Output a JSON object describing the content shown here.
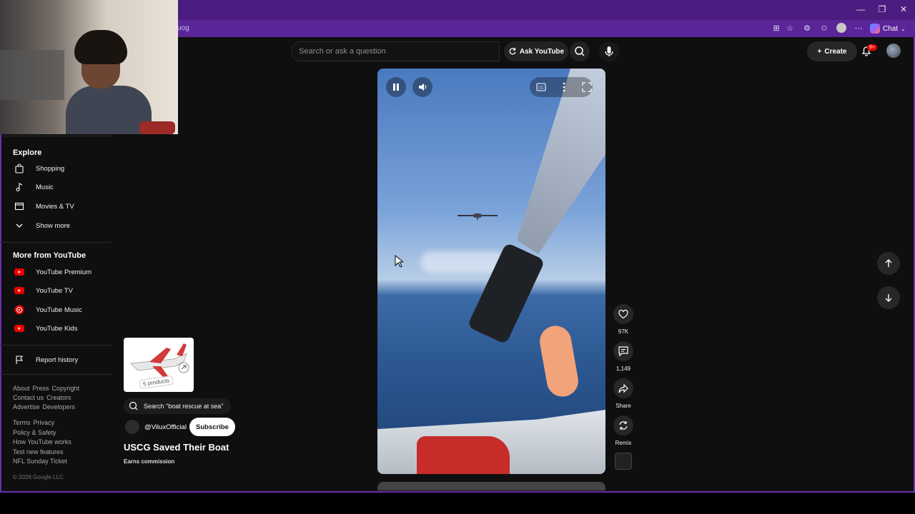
{
  "browser": {
    "address_text": "uog",
    "chat_label": "Chat",
    "window_buttons": [
      "—",
      "❐",
      "✕"
    ]
  },
  "topbar": {
    "search_placeholder": "Search or ask a question",
    "ask_label": "Ask YouTube",
    "create_label": "Create",
    "notification_badge": "9+"
  },
  "sidebar": {
    "explore_title": "Explore",
    "explore_items": [
      {
        "label": "Shopping",
        "icon": "shopping-bag-icon"
      },
      {
        "label": "Music",
        "icon": "music-note-icon"
      },
      {
        "label": "Movies & TV",
        "icon": "film-icon"
      },
      {
        "label": "Show more",
        "icon": "chevron-down-icon"
      }
    ],
    "more_title": "More from YouTube",
    "more_items": [
      {
        "label": "YouTube Premium",
        "icon": "youtube-premium-icon"
      },
      {
        "label": "YouTube TV",
        "icon": "youtube-tv-icon"
      },
      {
        "label": "YouTube Music",
        "icon": "youtube-music-icon"
      },
      {
        "label": "YouTube Kids",
        "icon": "youtube-kids-icon"
      }
    ],
    "report_history": "Report history",
    "footer_links_1": [
      "About",
      "Press",
      "Copyright",
      "Contact us",
      "Creators",
      "Advertise",
      "Developers"
    ],
    "footer_links_2": [
      "Terms",
      "Privacy",
      "Policy & Safety",
      "How YouTube works",
      "Test new features",
      "NFL Sunday Ticket"
    ],
    "copyright": "© 2026 Google LLC"
  },
  "short": {
    "products_tag": "5 products",
    "search_chip": "Search \"boat rescue at sea\"",
    "channel_name": "@ViluxOfficial",
    "subscribe_label": "Subscribe",
    "title": "USCG Saved Their Boat",
    "earns": "Earns commission",
    "likes": "97K",
    "comments": "1,149",
    "share_label": "Share",
    "remix_label": "Remix"
  }
}
